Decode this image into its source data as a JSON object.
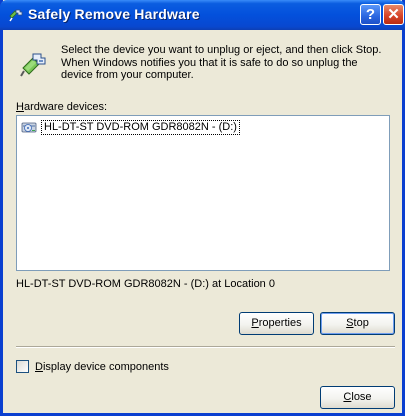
{
  "window": {
    "title": "Safely Remove Hardware",
    "help_label": "?",
    "close_label": "✕"
  },
  "instructions": "Select the device you want to unplug or eject, and then click Stop. When Windows notifies you that it is safe to do so unplug the device from your computer.",
  "devices": {
    "label_mnemonic": "H",
    "label_rest": "ardware devices:",
    "items": [
      {
        "label": "HL-DT-ST DVD-ROM GDR8082N - (D:)",
        "icon": "dvd-drive-icon",
        "selected": true
      }
    ]
  },
  "location_text": "HL-DT-ST DVD-ROM GDR8082N - (D:) at Location 0",
  "buttons": {
    "properties_mnemonic": "P",
    "properties_rest": "roperties",
    "stop_mnemonic": "S",
    "stop_rest": "top",
    "close_mnemonic": "C",
    "close_rest": "lose"
  },
  "display_components": {
    "mnemonic": "D",
    "rest": "isplay device components",
    "checked": false
  },
  "colors": {
    "titlebar": "#0350dc",
    "dialog_bg": "#ece9d8",
    "list_border": "#7f9db9"
  }
}
